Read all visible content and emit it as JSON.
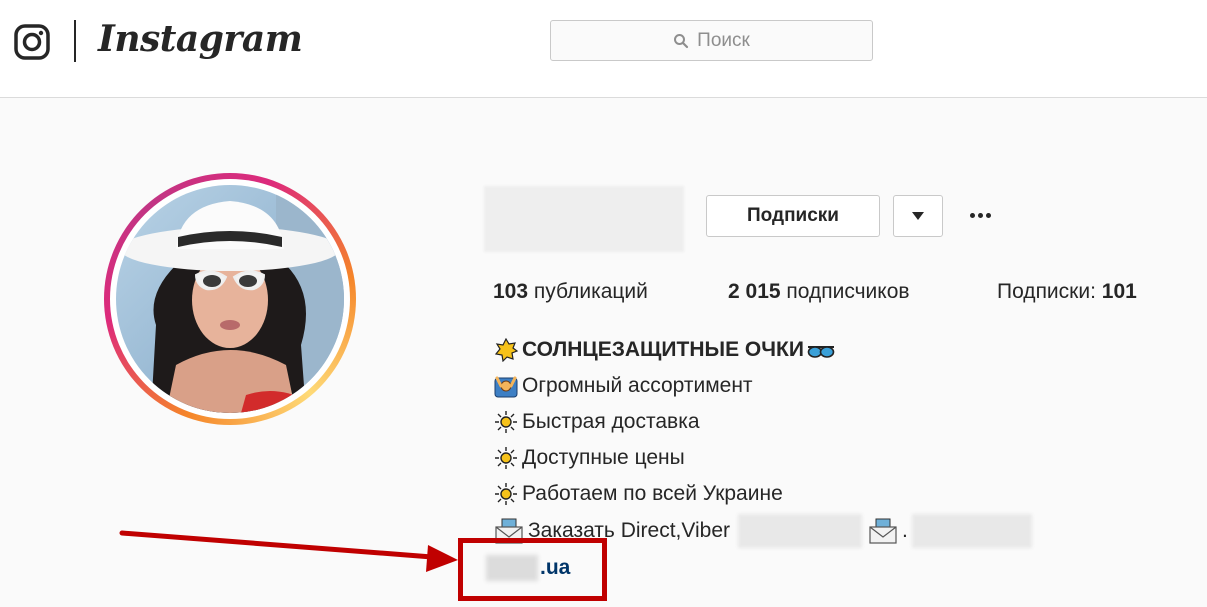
{
  "header": {
    "brand": "Instagram",
    "search_placeholder": "Поиск"
  },
  "profile": {
    "follow_button_label": "Подписки",
    "stats": {
      "posts_count": "103",
      "posts_label": "публикаций",
      "followers_count": "2 015",
      "followers_label": "подписчиков",
      "following_label": "Подписки:",
      "following_count": "101"
    },
    "bio": {
      "title": "СОЛНЦЕЗАЩИТНЫЕ ОЧКИ",
      "lines": [
        "Огромный ассортимент",
        "Быстрая доставка",
        "Доступные цены",
        "Работаем по всей Украине",
        "Заказать Direct,Viber"
      ],
      "line5_separator": "."
    },
    "website_suffix": ".ua"
  },
  "annotation": {
    "color": "#c00000"
  },
  "icons": {
    "logo": "instagram-glyph-icon",
    "search": "search-icon",
    "dropdown": "caret-down-icon",
    "more": "more-dots-icon",
    "bio_title": "sun-icon",
    "bio_title_end": "sunglasses-icon",
    "bio_line1": "person-raising-hands-icon",
    "bio_bullet": "sun-flower-icon",
    "bio_mail": "envelope-icon"
  }
}
